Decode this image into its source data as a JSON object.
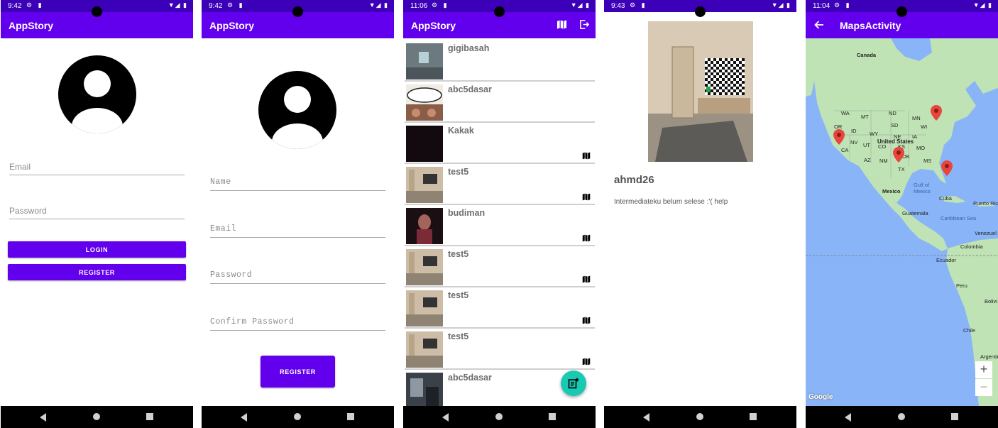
{
  "screens": {
    "login": {
      "status_time": "9:42",
      "title": "AppStory",
      "email_placeholder": "Email",
      "password_placeholder": "Password",
      "login_label": "LOGIN",
      "register_label": "REGISTER"
    },
    "register": {
      "status_time": "9:42",
      "title": "AppStory",
      "name_placeholder": "Name",
      "email_placeholder": "Email",
      "password_placeholder": "Password",
      "confirm_placeholder": "Confirm Password",
      "register_label": "REGISTER"
    },
    "list": {
      "status_time": "11:06",
      "title": "AppStory",
      "stories": [
        {
          "name": "gigibasah",
          "has_location": false
        },
        {
          "name": "abc5dasar",
          "has_location": false
        },
        {
          "name": "Kakak",
          "has_location": true
        },
        {
          "name": "test5",
          "has_location": true
        },
        {
          "name": "budiman",
          "has_location": true
        },
        {
          "name": "test5",
          "has_location": true
        },
        {
          "name": "test5",
          "has_location": true
        },
        {
          "name": "test5",
          "has_location": true
        },
        {
          "name": "abc5dasar",
          "has_location": false
        }
      ]
    },
    "detail": {
      "status_time": "9:43",
      "name": "ahmd26",
      "description": "Intermediateku belum selese :'( help"
    },
    "maps": {
      "status_time": "11:04",
      "title": "MapsActivity",
      "labels": {
        "canada": "Canada",
        "wa": "WA",
        "mt": "MT",
        "nd": "ND",
        "mn": "MN",
        "or": "OR",
        "id": "ID",
        "sd": "SD",
        "wi": "WI",
        "wy": "WY",
        "ia": "IA",
        "ne": "NE",
        "nv": "NV",
        "ut": "UT",
        "co": "CO",
        "ks": "KS",
        "mo": "MO",
        "ca": "CA",
        "az": "AZ",
        "nm": "NM",
        "ok": "OK",
        "tx": "TX",
        "ms": "MS",
        "united_states": "United States",
        "mexico": "Mexico",
        "gulf_of_mexico": "Gulf of Mexico",
        "cuba": "Cuba",
        "puerto_rico": "Puerto Ric",
        "guatemala": "Guatemala",
        "caribbean_sea": "Caribbean Sea",
        "venezuela": "Venezuel",
        "colombia": "Colombia",
        "ecuador": "Ecuador",
        "peru": "Peru",
        "bolivia": "Bolivi",
        "chile": "Chile",
        "argentina": "Argentin",
        "google": "Google"
      },
      "zoom_in": "+",
      "zoom_out": "−"
    }
  },
  "colors": {
    "primary": "#6200ee",
    "status_bar": "#3b00b8",
    "fab": "#18c9b4",
    "map_water": "#8ab4f8",
    "map_land": "#bfe3b4",
    "pin": "#e8453c"
  }
}
